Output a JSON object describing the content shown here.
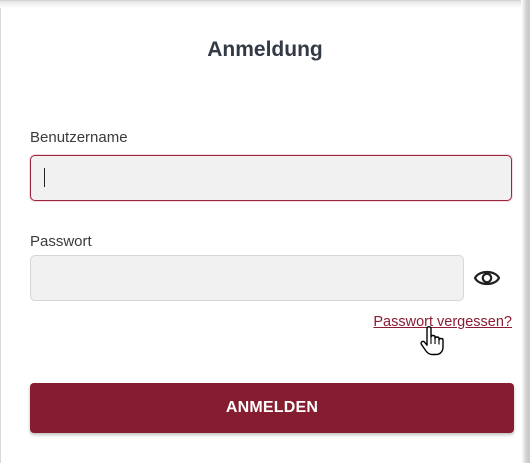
{
  "login": {
    "title": "Anmeldung",
    "username_label": "Benutzername",
    "username_value": "",
    "password_label": "Passwort",
    "password_value": "",
    "forgot_link": "Passwort vergessen?",
    "submit_label": "ANMELDEN"
  },
  "icons": {
    "password_toggle": "eye-icon",
    "cursor": "hand-pointer-icon"
  },
  "colors": {
    "accent": "#861c30",
    "focus_border": "#9b2541",
    "link": "#8b1c33",
    "title": "#333a45"
  }
}
